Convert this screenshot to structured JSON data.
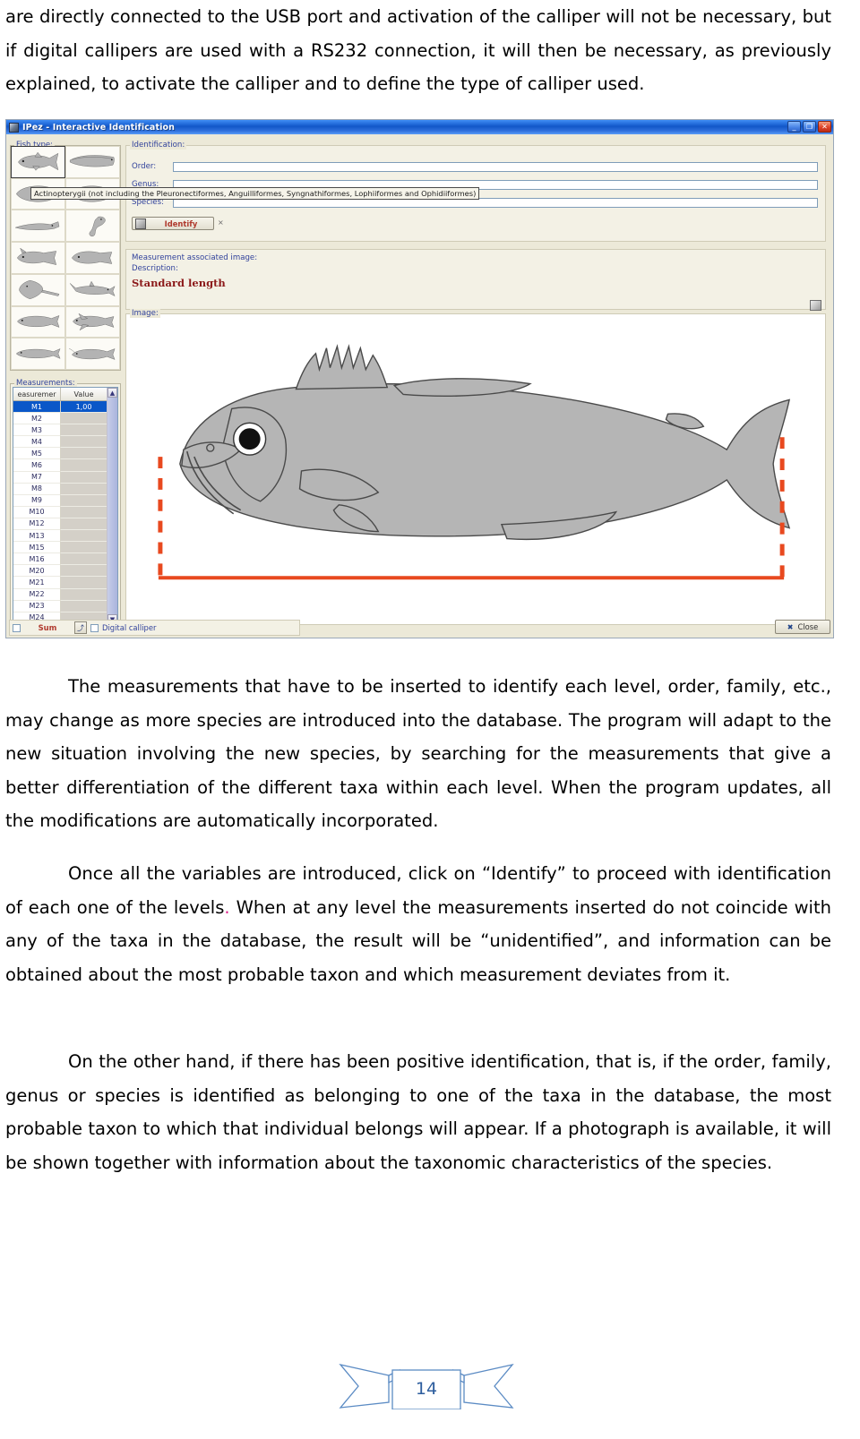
{
  "document": {
    "top_paragraph": "are directly connected to the USB port and activation of the calliper will not be necessary, but if digital callipers are used with a RS232 connection, it will then be necessary, as previously explained, to activate the calliper and to define the type of calliper used.",
    "para_2": "The measurements that have to be inserted to identify each level, order, family, etc., may change as more species are introduced into the database. The program will adapt to the new situation involving the new species, by searching for the measurements that give a better differentiation of the different taxa within each level. When the program updates, all the modifications are automatically incorporated.",
    "para_3_a": "Once all the variables are introduced, click on “Identify” to proceed with identification of each one of the levels",
    "para_3_dot": ".",
    "para_3_b": " When at any level the measurements inserted do not coincide with any of the taxa in the database, the result will be “unidentified”, and information can be obtained about the most probable taxon and which measurement deviates from it.",
    "para_4": "On the other hand, if there has been positive identification, that is, if the order, family, genus or species is identified as belonging to one of the taxa in the database, the most probable taxon to which that individual belongs will appear. If a photograph is available, it will be shown together with information about the taxonomic characteristics of the species.",
    "page_number": "14"
  },
  "app": {
    "title": "IPez - Interactive Identification",
    "window_buttons": {
      "minimize": "_",
      "maximize": "❐",
      "close": "✕"
    },
    "fish_type": {
      "label": "Fish type:",
      "tooltip": "Actinopterygii (not including the Pleuronectiformes, Anguilliformes, Syngnathiformes, Lophiiformes and Ophidiiformes)",
      "selected_index": 0
    },
    "identification": {
      "label": "Identification:",
      "fields": [
        {
          "label": "Order:",
          "value": ""
        },
        {
          "label": "Genus:",
          "value": ""
        },
        {
          "label": "Species:",
          "value": ""
        }
      ],
      "identify_button": "Identify",
      "identify_close": "×"
    },
    "measurement_image": {
      "assoc_label": "Measurement associated image:",
      "description_label": "Description:",
      "description_value": "Standard length"
    },
    "image_panel": {
      "label": "Image:",
      "measure_number": "1"
    },
    "measurements": {
      "label": "Measurements:",
      "columns": [
        "easuremer",
        "Value"
      ],
      "scroll_up": "▲",
      "scroll_down": "▼",
      "rows": [
        {
          "name": "M1",
          "value": "1,00",
          "selected": true
        },
        {
          "name": "M2",
          "value": "",
          "selected": false
        },
        {
          "name": "M3",
          "value": "",
          "selected": false
        },
        {
          "name": "M4",
          "value": "",
          "selected": false
        },
        {
          "name": "M5",
          "value": "",
          "selected": false
        },
        {
          "name": "M6",
          "value": "",
          "selected": false
        },
        {
          "name": "M7",
          "value": "",
          "selected": false
        },
        {
          "name": "M8",
          "value": "",
          "selected": false
        },
        {
          "name": "M9",
          "value": "",
          "selected": false
        },
        {
          "name": "M10",
          "value": "",
          "selected": false
        },
        {
          "name": "M12",
          "value": "",
          "selected": false
        },
        {
          "name": "M13",
          "value": "",
          "selected": false
        },
        {
          "name": "M15",
          "value": "",
          "selected": false
        },
        {
          "name": "M16",
          "value": "",
          "selected": false
        },
        {
          "name": "M20",
          "value": "",
          "selected": false
        },
        {
          "name": "M21",
          "value": "",
          "selected": false
        },
        {
          "name": "M22",
          "value": "",
          "selected": false
        },
        {
          "name": "M23",
          "value": "",
          "selected": false
        },
        {
          "name": "M24",
          "value": "",
          "selected": false
        }
      ]
    },
    "bottom_bar": {
      "sum_checkbox_checked": false,
      "sum_label": "Sum",
      "export_icon": "⤴",
      "digital_calliper_checked": false,
      "digital_calliper_label": "Digital calliper",
      "close_label": "Close",
      "close_icon": "✖"
    }
  },
  "colors": {
    "title_blue": "#1257c9",
    "label_blue": "#31429b",
    "accent_red": "#b03a2e",
    "measure_orange": "#e8491f",
    "selection_blue": "#0a57c8",
    "window_face": "#ece9d8",
    "ribbon_blue": "#5b8bc4"
  }
}
